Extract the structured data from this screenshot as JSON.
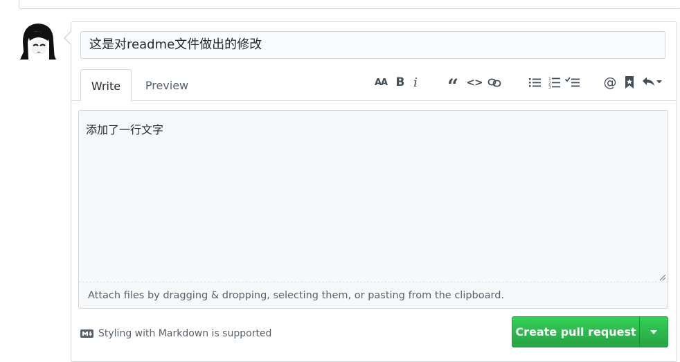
{
  "pull_request": {
    "title_value": "这是对readme文件做出的修改",
    "body_value": "添加了一行文字"
  },
  "tabs": [
    {
      "label": "Write",
      "active": true
    },
    {
      "label": "Preview",
      "active": false
    }
  ],
  "toolbar": {
    "icons": [
      "text-size-icon",
      "bold-icon",
      "italic-icon",
      "quote-icon",
      "code-icon",
      "link-icon",
      "bullet-list-icon",
      "numbered-list-icon",
      "task-list-icon",
      "mention-icon",
      "saved-reply-icon",
      "reply-icon"
    ],
    "heading_glyph": "AA",
    "bold_glyph": "B",
    "italic_glyph": "i",
    "quote_glyph": "“",
    "code_glyph": "<>",
    "mention_glyph": "@"
  },
  "editor": {
    "drop_hint": "Attach files by dragging & dropping, selecting them, or pasting from the clipboard."
  },
  "footer": {
    "markdown_note": "Styling with Markdown is supported",
    "submit_label": "Create pull request"
  },
  "colors": {
    "accent_green": "#28a745",
    "border": "#d1d5da",
    "muted_text": "#586069"
  }
}
